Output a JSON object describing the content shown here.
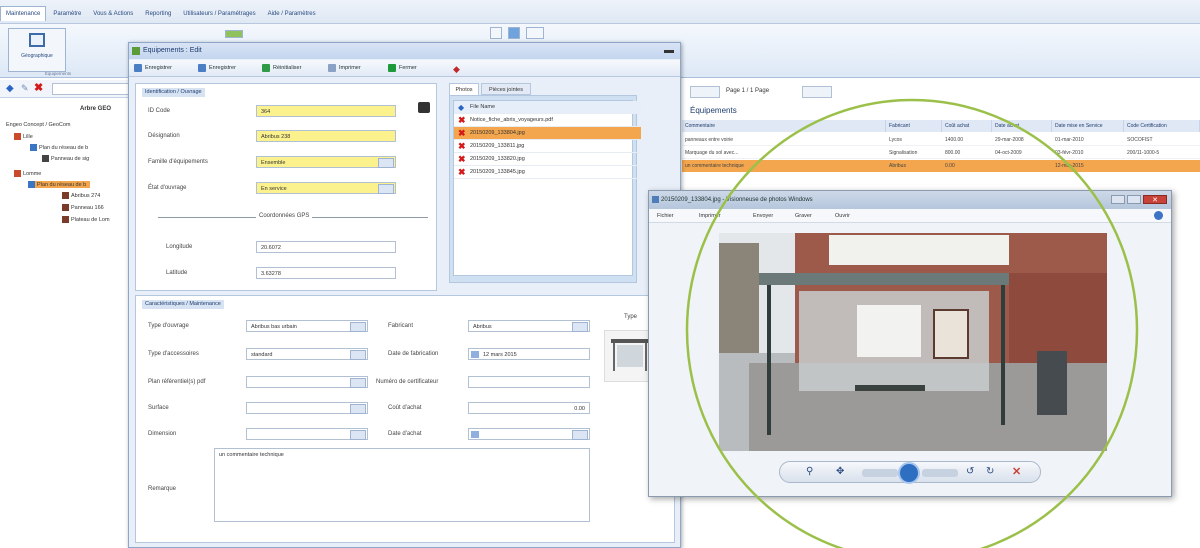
{
  "menubar": {
    "items": [
      "Maintenance",
      "Paramètre",
      "Vous & Actions",
      "Reporting",
      "Utilisateurs / Paramétrages",
      "Aide / Paramètres"
    ]
  },
  "ribbon": {
    "buttons": [
      "Géographique",
      "Equipements"
    ]
  },
  "tree": {
    "header": "Arbre GEO",
    "nodes": [
      "Engeo Concept / GeoCom",
      "Lille",
      "Plan du réseau de b",
      "Panneau de sig",
      "Lomme",
      "Plan du réseau de b",
      "Abribus 274",
      "Panneau 166",
      "Plateau de Lom"
    ]
  },
  "dialog": {
    "title": "Equipements : Edit",
    "toolbar": [
      "Enregistrer",
      "Enregistrer",
      "Réinitialiser",
      "Imprimer",
      "Fermer"
    ],
    "section1": {
      "title": "Identification / Ouvrage",
      "id_label": "ID Code",
      "id_value": "364",
      "designation_label": "Désignation",
      "designation_value": "Abribus 238",
      "family_label": "Famille d'équipements",
      "family_value": "Ensemble",
      "state_label": "État d'ouvrage",
      "state_value": "En service",
      "coords_title": "Coordonnées GPS",
      "longitude_label": "Longitude",
      "longitude_value": "20.6072",
      "latitude_label": "Latitude",
      "latitude_value": "3.63278"
    },
    "tabs": [
      "Photos",
      "Pièces jointes"
    ],
    "photos_header": "File Name",
    "photos": [
      "Notice_fiche_abris_voyageurs.pdf",
      "20150209_133804.jpg",
      "20150209_133811.jpg",
      "20150209_133820.jpg",
      "20150209_133845.jpg"
    ],
    "section2": {
      "title": "Caractéristiques / Maintenance",
      "type_ouvrage_label": "Type d'ouvrage",
      "type_ouvrage_value": "Abribus bas urbain",
      "type_acces_label": "Type d'accessoires",
      "type_acces_value": "standard",
      "plan_label": "Plan référentiel(s) pdf",
      "surface_label": "Surface",
      "dimension_label": "Dimension",
      "remark_label": "Remarque",
      "remark_value": "un commentaire technique",
      "fabricant_label": "Fabricant",
      "fabricant_value": "Abribus",
      "date_fab_label": "Date de fabrication",
      "date_fab_value": "12 mars 2015",
      "cert_label": "Numéro de certificateur",
      "cout_label": "Coût d'achat",
      "cout_value": "0.00",
      "date_achat_label": "Date d'achat",
      "type_label": "Type"
    }
  },
  "equipments": {
    "pagination": "Page 1 / 1 Page",
    "title": "Équipements",
    "columns": [
      "Commentaire",
      "Fabricant",
      "Coût achat",
      "Date achat",
      "Date mise en Service",
      "Code Certification"
    ],
    "rows": [
      [
        "panneaux entre voirie",
        "Lycos",
        "1400.00",
        "29-mar-2008",
        "01-mar-2010",
        "SOCOFIST"
      ],
      [
        "Marquage du sol avec...",
        "Signalisation",
        "800.00",
        "04-oct-2009",
        "03-févr-2010",
        "200/11-1000-5"
      ],
      [
        "un commentaire technique",
        "Abribus",
        "0.00",
        "",
        "12-mar-2015",
        ""
      ]
    ],
    "selected_row": 2
  },
  "viewer": {
    "title": "20150209_133804.jpg - Visionneuse de photos Windows",
    "menu": [
      "Fichier",
      "Imprimer",
      "Envoyer",
      "Graver",
      "Ouvrir"
    ]
  },
  "colors": {
    "accent": "#f3a64d",
    "highlight_circle": "#9bc04a",
    "required_field": "#fbf28d"
  }
}
